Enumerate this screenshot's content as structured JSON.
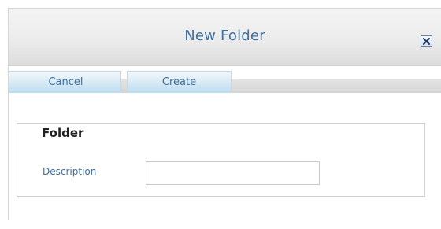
{
  "dialog": {
    "title": "New Folder"
  },
  "toolbar": {
    "cancel_label": "Cancel",
    "create_label": "Create"
  },
  "form": {
    "group_legend": "Folder",
    "description_label": "Description",
    "description_value": "",
    "description_placeholder": ""
  },
  "icons": {
    "close": "close-icon"
  },
  "colors": {
    "accent_text": "#3d6f9f",
    "button_blue": "#bcdcef"
  }
}
